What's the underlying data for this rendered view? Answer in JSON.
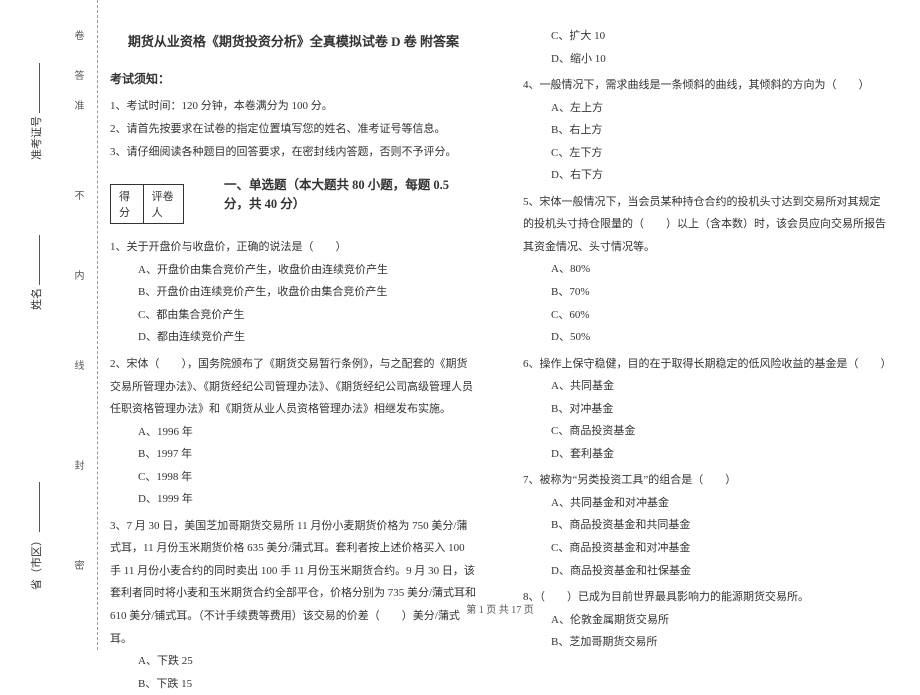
{
  "binding": {
    "mi": "密",
    "feng": "封",
    "xian": "线",
    "nei": "内",
    "bu": "不",
    "zhun": "准",
    "da": "答",
    "juan": "卷"
  },
  "side": {
    "province": "省（市区）",
    "name": "姓名",
    "admission": "准考证号"
  },
  "header": {
    "title": "期货从业资格《期货投资分析》全真模拟试卷 D 卷 附答案",
    "notice_h": "考试须知：",
    "n1": "1、考试时间：120 分钟，本卷满分为 100 分。",
    "n2": "2、请首先按要求在试卷的指定位置填写您的姓名、准考证号等信息。",
    "n3": "3、请仔细阅读各种题目的回答要求，在密封线内答题，否则不予评分。"
  },
  "scorebox": {
    "score": "得分",
    "rater": "评卷人"
  },
  "section1": "一、单选题（本大题共 80 小题，每题 0.5 分，共 40 分）",
  "q1": {
    "stem": "1、关于开盘价与收盘价，正确的说法是（　　）",
    "a": "A、开盘价由集合竞价产生，收盘价由连续竞价产生",
    "b": "B、开盘价由连续竞价产生，收盘价由集合竞价产生",
    "c": "C、都由集合竞价产生",
    "d": "D、都由连续竞价产生"
  },
  "q2": {
    "stem": "2、宋体（　　），国务院颁布了《期货交易暂行条例》，与之配套的《期货交易所管理办法》、《期货经纪公司管理办法》、《期货经纪公司高级管理人员任职资格管理办法》和《期货从业人员资格管理办法》相继发布实施。",
    "a": "A、1996 年",
    "b": "B、1997 年",
    "c": "C、1998 年",
    "d": "D、1999 年"
  },
  "q3": {
    "stem": "3、7 月 30 日，美国芝加哥期货交易所 11 月份小麦期货价格为 750 美分/蒲式耳，11 月份玉米期货价格 635 美分/蒲式耳。套利者按上述价格买入 100 手 11 月份小麦合约的同时卖出 100 手 11 月份玉米期货合约。9 月 30 日，该套利者同时将小麦和玉米期货合约全部平仓，价格分别为 735 美分/蒲式耳和 610 美分/铺式耳。（不计手续费等费用）该交易的价差（　　）美分/蒲式耳。",
    "a": "A、下跌 25",
    "b": "B、下跌 15",
    "c": "C、扩大 10",
    "d": "D、缩小 10"
  },
  "q4": {
    "stem": "4、一般情况下，需求曲线是一条倾斜的曲线，其倾斜的方向为（　　）",
    "a": "A、左上方",
    "b": "B、右上方",
    "c": "C、左下方",
    "d": "D、右下方"
  },
  "q5": {
    "stem": "5、宋体一般情况下，当会员某种持仓合约的投机头寸达到交易所对其规定的投机头寸持仓限量的（　　）以上（含本数）时，该会员应向交易所报告其资金情况、头寸情况等。",
    "a": "A、80%",
    "b": "B、70%",
    "c": "C、60%",
    "d": "D、50%"
  },
  "q6": {
    "stem": "6、操作上保守稳健，目的在于取得长期稳定的低风险收益的基金是（　　）",
    "a": "A、共同基金",
    "b": "B、对冲基金",
    "c": "C、商品投资基金",
    "d": "D、套利基金"
  },
  "q7": {
    "stem": "7、被称为“另类投资工具”的组合是（　　）",
    "a": "A、共同基金和对冲基金",
    "b": "B、商品投资基金和共同基金",
    "c": "C、商品投资基金和对冲基金",
    "d": "D、商品投资基金和社保基金"
  },
  "q8": {
    "stem": "8、（　　）已成为目前世界最具影响力的能源期货交易所。",
    "a": "A、伦敦金属期货交易所",
    "b": "B、芝加哥期货交易所"
  },
  "footer": "第 1 页 共 17 页"
}
